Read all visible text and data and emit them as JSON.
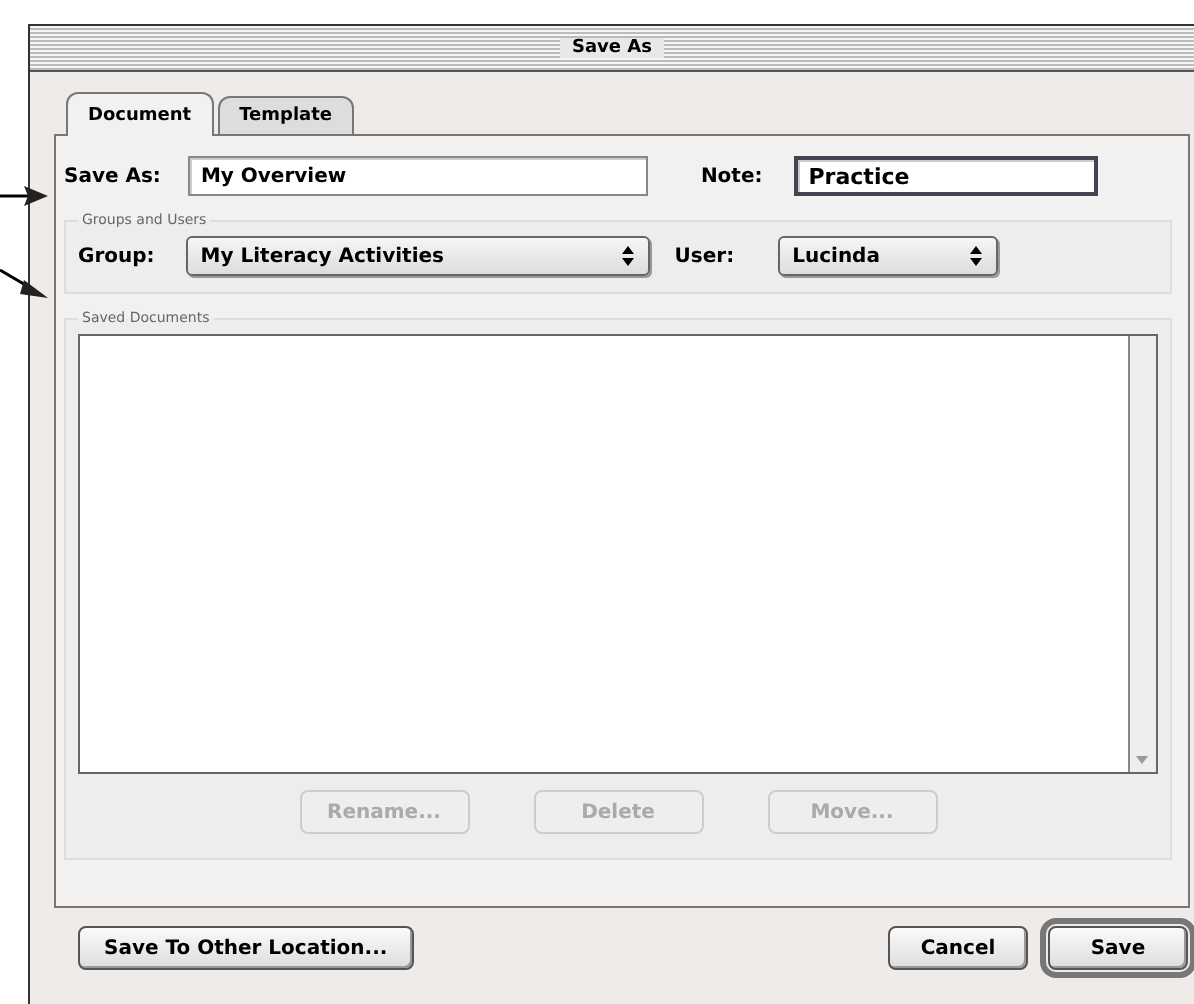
{
  "window": {
    "title": "Save As"
  },
  "tabs": [
    {
      "label": "Document",
      "selected": true
    },
    {
      "label": "Template",
      "selected": false
    }
  ],
  "save_as": {
    "label": "Save As:",
    "value": "My Overview"
  },
  "note": {
    "label": "Note:",
    "value": "Practice"
  },
  "groups_and_users": {
    "title": "Groups and Users",
    "group": {
      "label": "Group:",
      "value": "My Literacy Activities"
    },
    "user": {
      "label": "User:",
      "value": "Lucinda"
    }
  },
  "saved_documents": {
    "title": "Saved Documents",
    "buttons": [
      {
        "label": "Rename...",
        "disabled": true
      },
      {
        "label": "Delete",
        "disabled": true
      },
      {
        "label": "Move...",
        "disabled": true
      }
    ]
  },
  "buttons": [
    {
      "label": "Save To Other Location...",
      "default": false
    },
    {
      "label": "Cancel",
      "default": false
    },
    {
      "label": "Save",
      "default": true
    }
  ]
}
